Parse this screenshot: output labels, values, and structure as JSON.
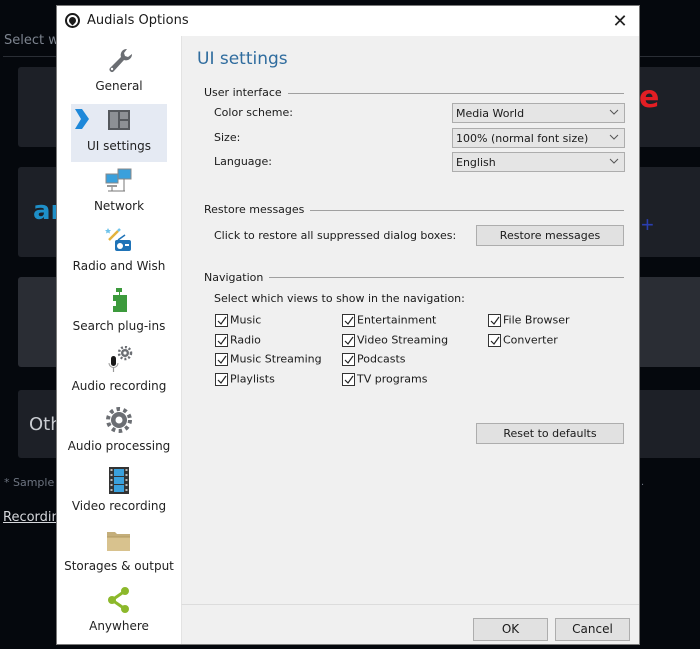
{
  "background_app": {
    "select_text": "Select wh",
    "card2_text": "am",
    "card4_text": "Oth",
    "sample_note": "* Sample",
    "sample_note_end": ".",
    "recording_link": "Recordin",
    "brand_letter": "e",
    "plus_glyph": "+"
  },
  "dialog": {
    "title": "Audials Options",
    "close_glyph": "✕"
  },
  "sidebar": {
    "items": [
      {
        "label": "General",
        "icon": "wrench-icon"
      },
      {
        "label": "UI settings",
        "icon": "layout-icon",
        "active": true
      },
      {
        "label": "Network",
        "icon": "network-icon"
      },
      {
        "label": "Radio and Wish",
        "icon": "radio-wand-icon"
      },
      {
        "label": "Search plug-ins",
        "icon": "puzzle-icon"
      },
      {
        "label": "Audio recording",
        "icon": "microphone-gear-icon"
      },
      {
        "label": "Audio processing",
        "icon": "gear-icon"
      },
      {
        "label": "Video recording",
        "icon": "film-icon"
      },
      {
        "label": "Storages & output",
        "icon": "folder-icon"
      },
      {
        "label": "Anywhere",
        "icon": "share-icon"
      }
    ]
  },
  "content": {
    "title": "UI settings",
    "user_interface": {
      "group_label": "User interface",
      "color_scheme_label": "Color scheme:",
      "color_scheme_value": "Media World",
      "size_label": "Size:",
      "size_value": "100% (normal font size)",
      "language_label": "Language:",
      "language_value": "English"
    },
    "restore": {
      "group_label": "Restore messages",
      "description": "Click to restore all suppressed dialog boxes:",
      "button_label": "Restore messages"
    },
    "navigation": {
      "group_label": "Navigation",
      "description": "Select which views to show in the navigation:",
      "views": [
        {
          "label": "Music",
          "checked": true
        },
        {
          "label": "Radio",
          "checked": true
        },
        {
          "label": "Music Streaming",
          "checked": true
        },
        {
          "label": "Playlists",
          "checked": true
        },
        {
          "label": "Entertainment",
          "checked": true
        },
        {
          "label": "Video Streaming",
          "checked": true
        },
        {
          "label": "Podcasts",
          "checked": true
        },
        {
          "label": "TV programs",
          "checked": true
        },
        {
          "label": "File Browser",
          "checked": true
        },
        {
          "label": "Converter",
          "checked": true
        }
      ],
      "reset_button_label": "Reset to defaults"
    }
  },
  "footer": {
    "ok_label": "OK",
    "cancel_label": "Cancel"
  },
  "colors": {
    "accent_title": "#2f6c9e",
    "active_arrow": "#1e88d9",
    "active_item_bg": "#e5eaf3"
  }
}
